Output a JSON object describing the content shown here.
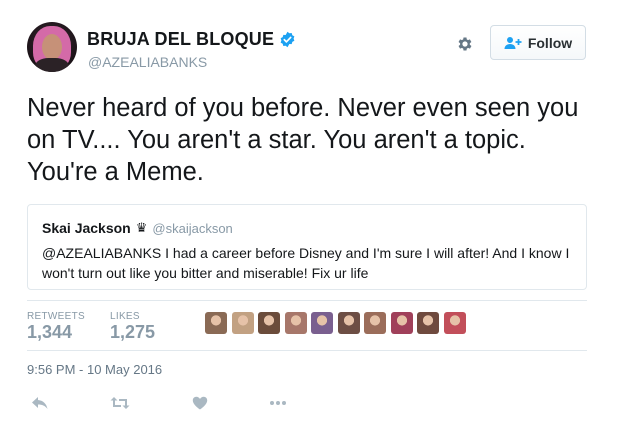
{
  "user": {
    "display_name": "BRUJA DEL BLOQUE",
    "handle": "@AZEALIABANKS",
    "verified": true
  },
  "header": {
    "settings_icon": "gear-icon",
    "follow_label": "Follow"
  },
  "tweet": {
    "text": "Never heard of you before. Never even seen you on TV.... You aren't a star. You aren't a topic. You're a Meme."
  },
  "quoted_tweet": {
    "name": "Skai Jackson",
    "badge": "♛",
    "handle": "@skaijackson",
    "text": "@AZEALIABANKS I had a career before Disney and I'm sure I will after! And I know I won't turn out like you bitter and miserable! Fix ur life"
  },
  "stats": {
    "retweets_label": "RETWEETS",
    "retweets_value": "1,344",
    "likes_label": "LIKES",
    "likes_value": "1,275",
    "liker_avatar_colors": [
      "#8a6a55",
      "#c2a182",
      "#6b4c3b",
      "#a7776a",
      "#7a5f8f",
      "#6d4e44",
      "#9b6d5a",
      "#a0405a",
      "#6f4a3e",
      "#c24f5a"
    ]
  },
  "timestamp": "9:56 PM - 10 May 2016",
  "colors": {
    "verified_blue": "#1da1f2",
    "muted_gray": "#8899a6",
    "action_gray": "#aab8c2"
  }
}
